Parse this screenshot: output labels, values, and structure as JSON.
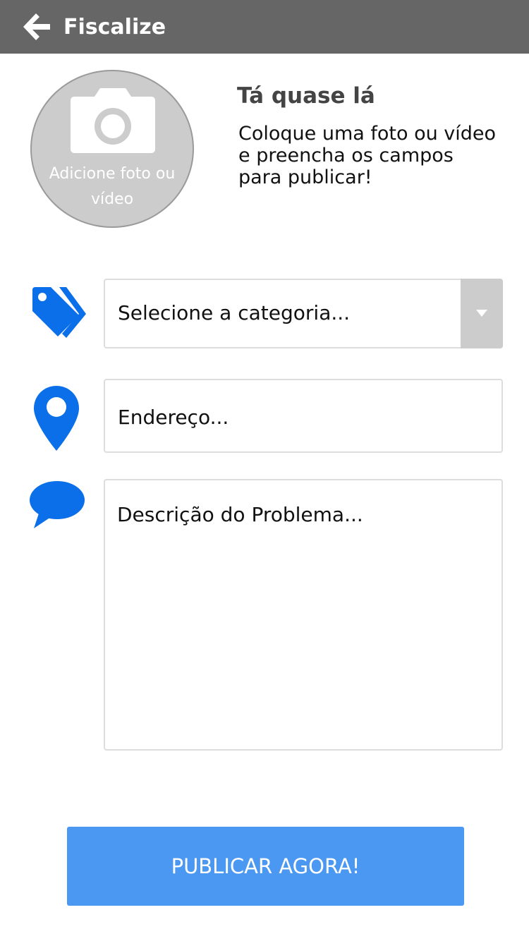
{
  "header": {
    "title": "Fiscalize",
    "back_icon": "arrow-left-icon",
    "background": "#666666"
  },
  "photo": {
    "label": "Adicione foto ou vídeo",
    "icon": "camera-icon"
  },
  "intro": {
    "headline": "Tá quase lá",
    "text": "Coloque uma foto ou vídeo e preencha os campos para publicar!"
  },
  "form": {
    "category": {
      "placeholder": "Selecione a categoria...",
      "icon": "tags-icon"
    },
    "address": {
      "placeholder": "Endereço...",
      "icon": "map-pin-icon"
    },
    "description": {
      "placeholder": "Descrição do Problema...",
      "icon": "speech-bubble-icon"
    }
  },
  "actions": {
    "publish_label": "PUBLICAR AGORA!"
  },
  "colors": {
    "accent": "#4a98f2",
    "icon_blue": "#0a6fe8",
    "placeholder_gray": "#cccccc"
  }
}
